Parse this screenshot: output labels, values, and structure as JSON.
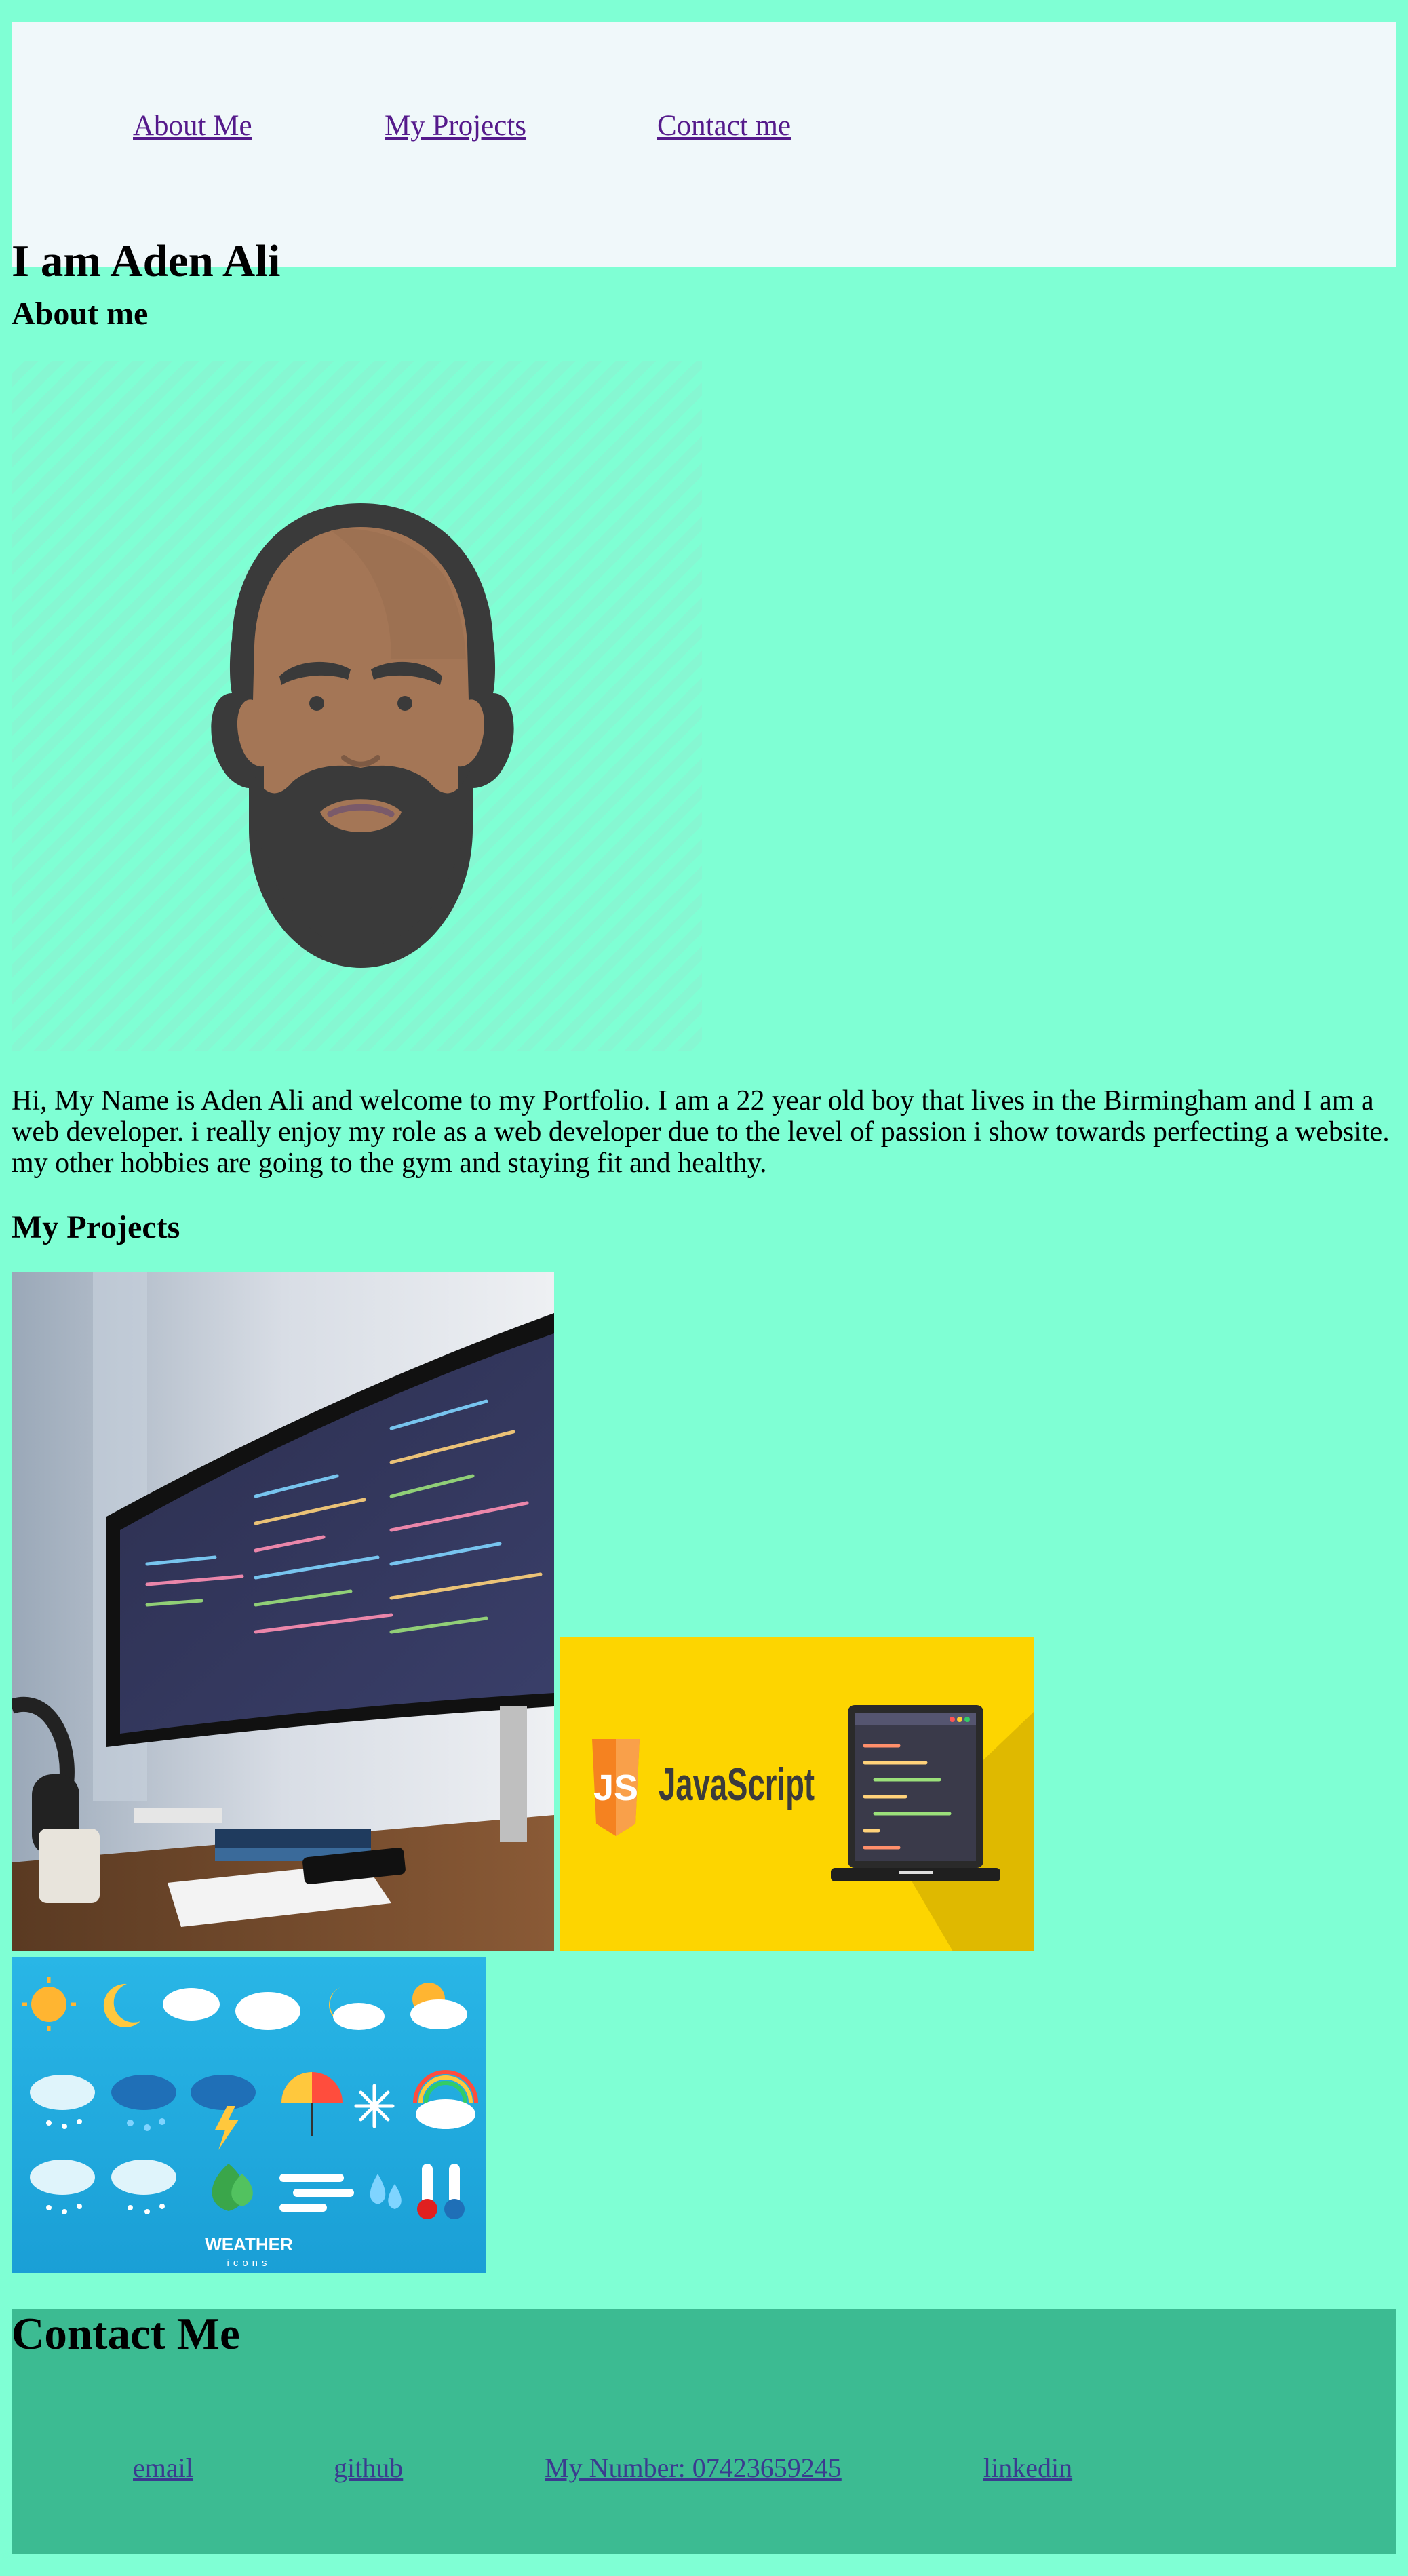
{
  "nav": {
    "items": [
      {
        "label": "About Me"
      },
      {
        "label": "My Projects"
      },
      {
        "label": "Contact me"
      }
    ]
  },
  "header": {
    "title": "I am Aden Ali"
  },
  "about": {
    "heading": "About me",
    "bio": "Hi, My Name is Aden Ali and welcome to my Portfolio. I am a 22 year old boy that lives in the Birmingham and I am a web developer. i really enjoy my role as a web developer due to the level of passion i show towards perfecting a website. my other hobbies are going to the gym and staying fit and healthy."
  },
  "projects": {
    "heading": "My Projects",
    "javascript_image": {
      "title": "JavaScript",
      "badge": "JS"
    },
    "weather_image": {
      "title": "WEATHER",
      "subtitle": "icons"
    }
  },
  "contact": {
    "heading": "Contact Me",
    "links": [
      {
        "label": "email"
      },
      {
        "label": "github"
      },
      {
        "label": "My Number: 07423659245"
      },
      {
        "label": "linkedin"
      }
    ]
  },
  "colors": {
    "page_background": "#7fffd4",
    "header_background": "#f0f8fa",
    "footer_background": "#3cbb92",
    "link": "#551a8b"
  }
}
